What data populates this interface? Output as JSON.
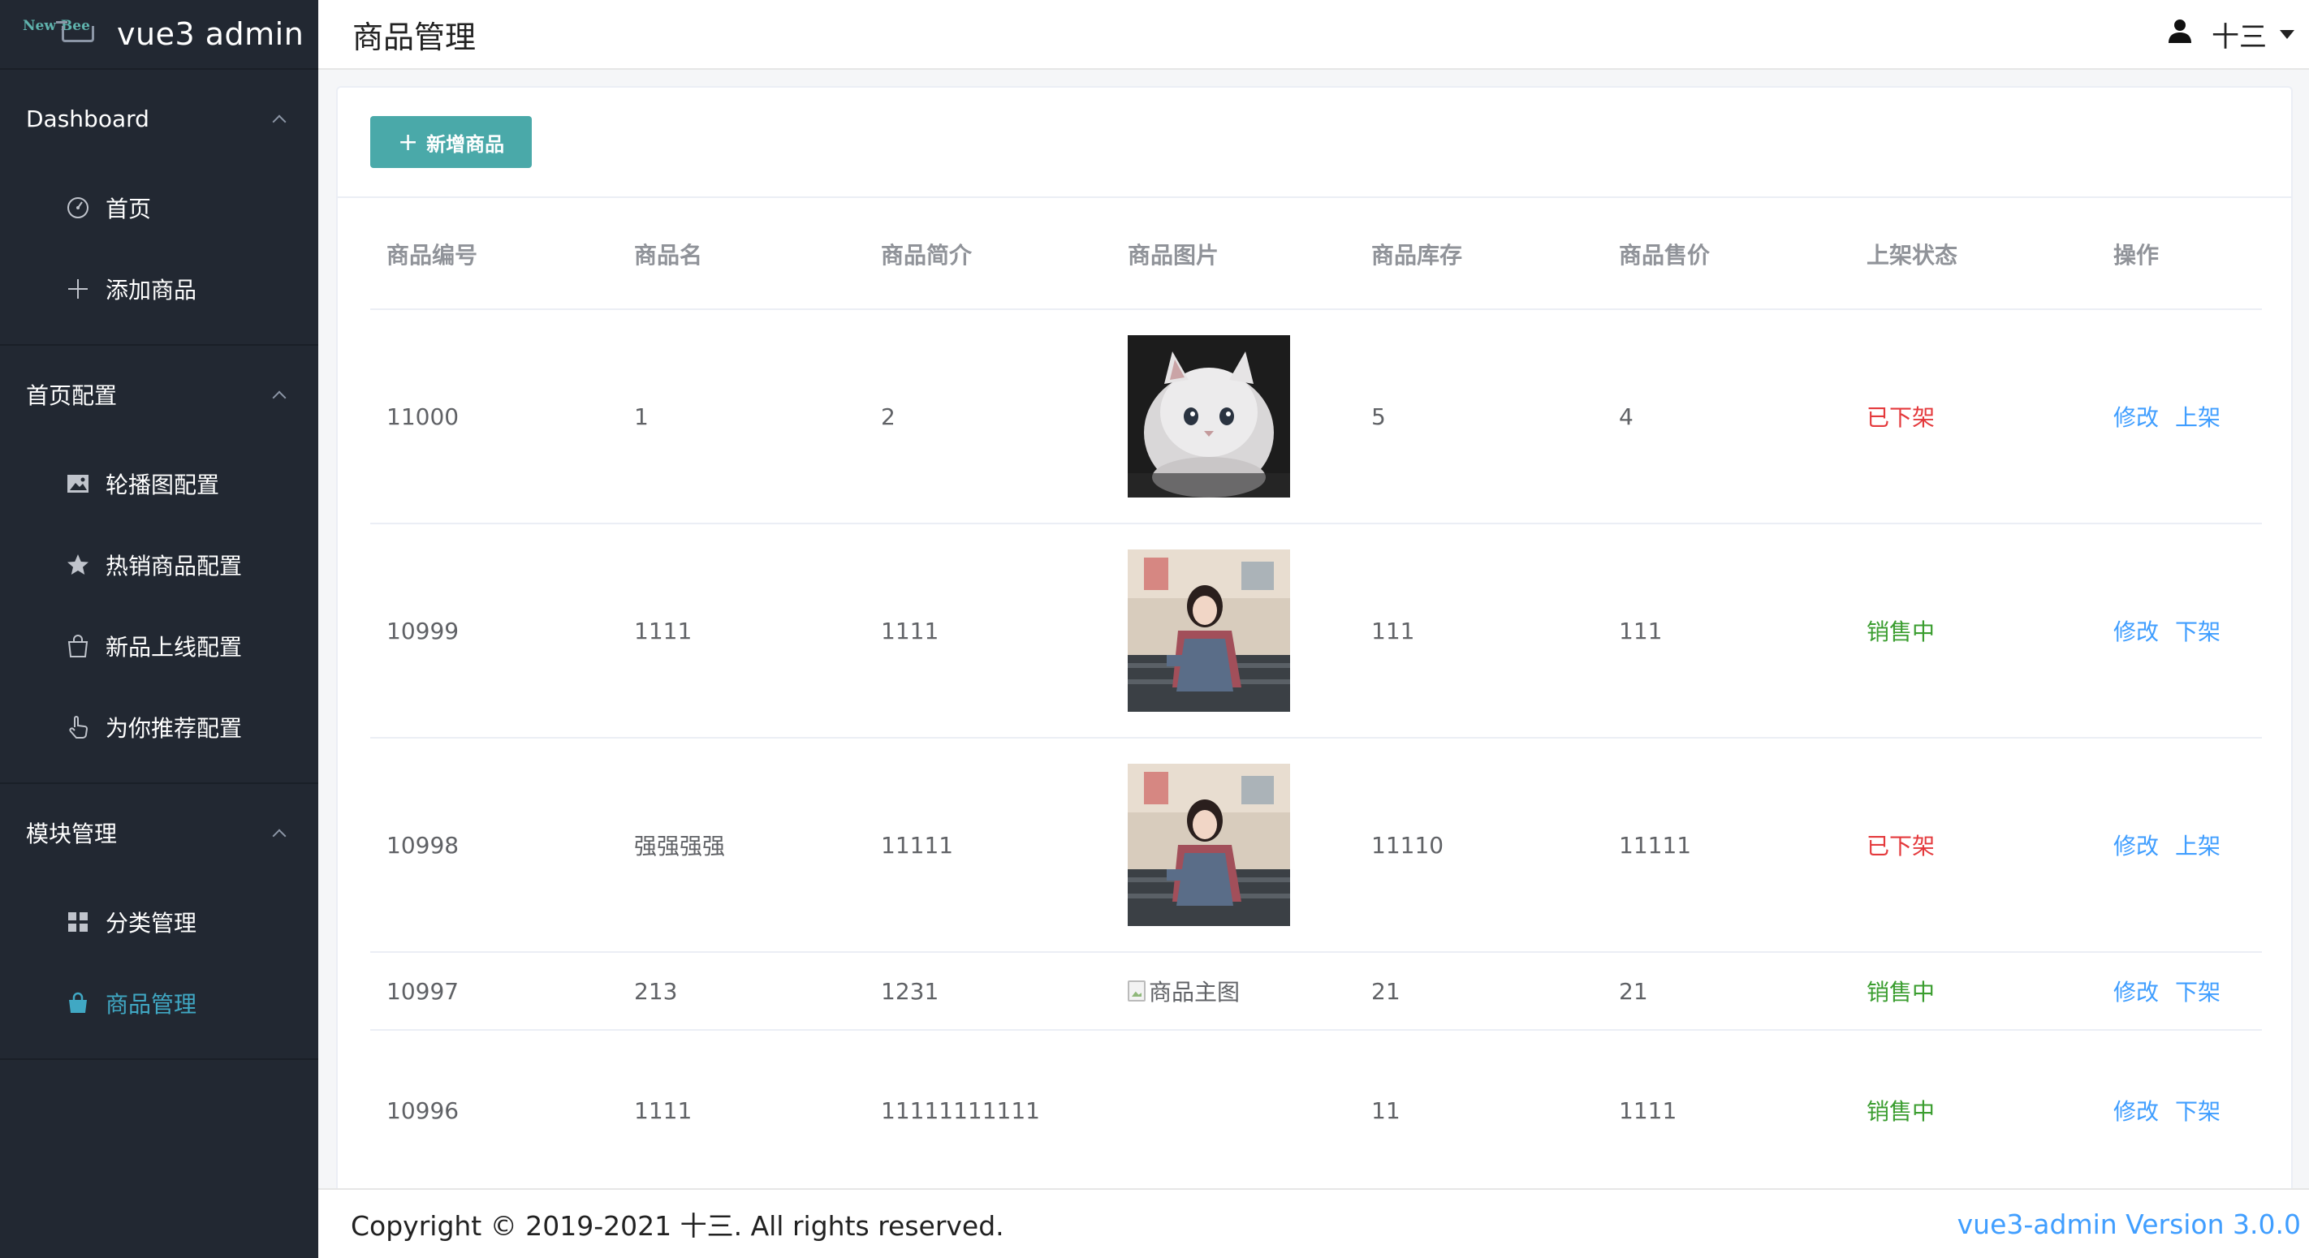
{
  "brand": {
    "logo_text": "New Bee",
    "title": "vue3 admin"
  },
  "sidebar": {
    "groups": [
      {
        "label": "Dashboard",
        "items": [
          {
            "label": "首页",
            "icon": "gauge-icon"
          },
          {
            "label": "添加商品",
            "icon": "plus-icon"
          }
        ]
      },
      {
        "label": "首页配置",
        "items": [
          {
            "label": "轮播图配置",
            "icon": "picture-icon"
          },
          {
            "label": "热销商品配置",
            "icon": "star-icon"
          },
          {
            "label": "新品上线配置",
            "icon": "shopping-bag-icon"
          },
          {
            "label": "为你推荐配置",
            "icon": "pointer-icon"
          }
        ]
      },
      {
        "label": "模块管理",
        "items": [
          {
            "label": "分类管理",
            "icon": "grid-icon"
          },
          {
            "label": "商品管理",
            "icon": "shopping-bag-filled-icon",
            "active": true
          }
        ]
      }
    ]
  },
  "header": {
    "title": "商品管理",
    "user": "十三"
  },
  "toolbar": {
    "add_label": "新增商品"
  },
  "table": {
    "columns": [
      "商品编号",
      "商品名",
      "商品简介",
      "商品图片",
      "商品库存",
      "商品售价",
      "上架状态",
      "操作"
    ],
    "rows": [
      {
        "id": "11000",
        "name": "1",
        "intro": "2",
        "image": "cat",
        "stock": "5",
        "price": "4",
        "status": "已下架",
        "status_type": "off",
        "edit": "修改",
        "toggle": "上架"
      },
      {
        "id": "10999",
        "name": "1111",
        "intro": "1111",
        "image": "girl",
        "stock": "111",
        "price": "111",
        "status": "销售中",
        "status_type": "on",
        "edit": "修改",
        "toggle": "下架"
      },
      {
        "id": "10998",
        "name": "强强强强",
        "intro": "11111",
        "image": "girl",
        "stock": "11110",
        "price": "11111",
        "status": "已下架",
        "status_type": "off",
        "edit": "修改",
        "toggle": "上架"
      },
      {
        "id": "10997",
        "name": "213",
        "intro": "1231",
        "image_alt": "商品主图",
        "stock": "21",
        "price": "21",
        "status": "销售中",
        "status_type": "on",
        "edit": "修改",
        "toggle": "下架"
      },
      {
        "id": "10996",
        "name": "1111",
        "intro": "11111111111",
        "stock": "11",
        "price": "1111",
        "status": "销售中",
        "status_type": "on",
        "edit": "修改",
        "toggle": "下架"
      }
    ]
  },
  "footer": {
    "copyright": "Copyright © 2019-2021 十三. All rights reserved.",
    "version": "vue3-admin Version 3.0.0"
  },
  "colors": {
    "sidebar_bg": "#222832",
    "accent": "#4aa9a9",
    "link": "#409eff",
    "status_off": "#e4393c",
    "status_on": "#3a9d2f"
  }
}
